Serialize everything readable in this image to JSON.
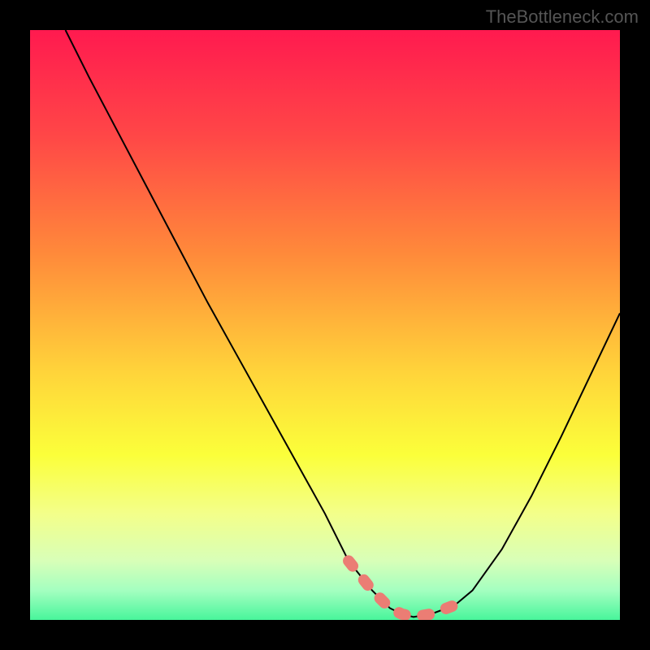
{
  "attribution": "TheBottleneck.com",
  "chart_data": {
    "type": "line",
    "title": "",
    "xlabel": "",
    "ylabel": "",
    "xlim": [
      0,
      100
    ],
    "ylim": [
      0,
      100
    ],
    "background_gradient_stops": [
      {
        "offset": 0.0,
        "color": "#ff1a4f"
      },
      {
        "offset": 0.18,
        "color": "#ff4747"
      },
      {
        "offset": 0.38,
        "color": "#ff8a3a"
      },
      {
        "offset": 0.58,
        "color": "#ffd43a"
      },
      {
        "offset": 0.72,
        "color": "#fbff3a"
      },
      {
        "offset": 0.82,
        "color": "#f3ff8a"
      },
      {
        "offset": 0.9,
        "color": "#d8ffb8"
      },
      {
        "offset": 0.95,
        "color": "#a4ffc0"
      },
      {
        "offset": 1.0,
        "color": "#48f59b"
      }
    ],
    "series": [
      {
        "name": "bottleneck-curve",
        "color": "#000000",
        "x": [
          6,
          10,
          15,
          20,
          25,
          30,
          35,
          40,
          45,
          50,
          54,
          58,
          61,
          63,
          65,
          68,
          72,
          75,
          80,
          85,
          90,
          95,
          100
        ],
        "y_pct": [
          100,
          92,
          82.5,
          73,
          63.5,
          54,
          45,
          36,
          27,
          18,
          10,
          5,
          2,
          1,
          0.5,
          1,
          2.5,
          5,
          12,
          21,
          31,
          41.5,
          52
        ]
      }
    ],
    "highlight_segment": {
      "color": "#eb7d74",
      "x_start": 54,
      "x_end": 72,
      "points_x": [
        54,
        58,
        61,
        63,
        65,
        68,
        72
      ],
      "points_y_pct": [
        10,
        5,
        2,
        1,
        0.5,
        1,
        2.5
      ]
    }
  }
}
